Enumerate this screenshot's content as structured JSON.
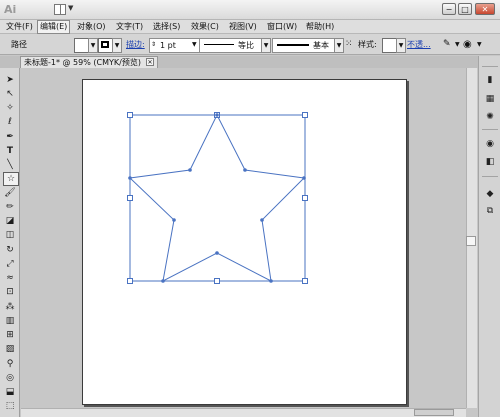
{
  "app": {
    "logo_text": "Ai"
  },
  "window_buttons": {
    "minimize": "−",
    "maximize": "□",
    "close": "✕"
  },
  "menubar": {
    "items": [
      {
        "label": "文件(F)"
      },
      {
        "label": "编辑(E)"
      },
      {
        "label": "对象(O)"
      },
      {
        "label": "文字(T)"
      },
      {
        "label": "选择(S)"
      },
      {
        "label": "效果(C)"
      },
      {
        "label": "视图(V)"
      },
      {
        "label": "窗口(W)"
      },
      {
        "label": "帮助(H)"
      }
    ]
  },
  "controlbar": {
    "object_label": "路径",
    "stroke_label": "描边:",
    "stroke_weight": "1 pt",
    "profile_label": "等比",
    "brush_label": "基本",
    "style_label": "样式:",
    "opacity_label": "不透..."
  },
  "document": {
    "tab_title": "未标题-1* @ 59% (CMYK/预览)"
  },
  "colors": {
    "selection_blue": "#4a73c2",
    "chrome": "#d5d5d5"
  },
  "tools": [
    "selection-tool",
    "direct-selection-tool",
    "magic-wand-tool",
    "lasso-tool",
    "pen-tool",
    "type-tool",
    "line-tool",
    "star-tool",
    "paintbrush-tool",
    "pencil-tool",
    "blob-brush-tool",
    "eraser-tool",
    "rotate-tool",
    "scale-tool",
    "warp-tool",
    "free-transform-tool",
    "symbol-sprayer-tool",
    "column-graph-tool",
    "mesh-tool",
    "gradient-tool",
    "eyedropper-tool",
    "blend-tool",
    "live-paint-tool",
    "artboard-tool"
  ],
  "panels": [
    "color-panel-icon",
    "swatches-panel-icon",
    "brushes-panel-icon",
    "symbols-panel-icon",
    "stroke-panel-icon",
    "gradient-panel-icon",
    "transparency-panel-icon",
    "appearance-panel-icon",
    "layers-panel-icon",
    "artboards-panel-icon"
  ]
}
